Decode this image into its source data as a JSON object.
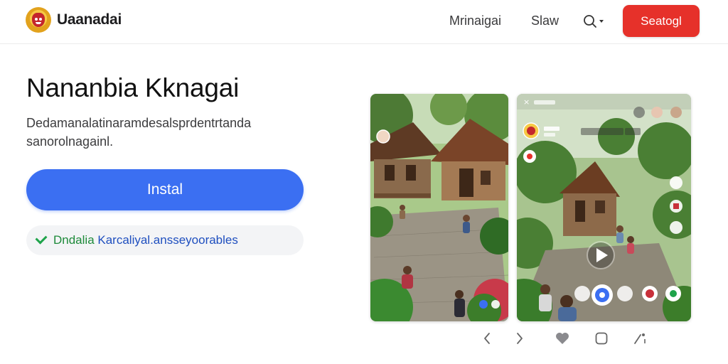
{
  "header": {
    "brand": "Uaanadai",
    "nav": [
      "Mrinaigai",
      "Slaw"
    ],
    "cta_label": "Seatogl",
    "icons": [
      "app-logo-icon",
      "search-icon",
      "chevron-down-icon"
    ]
  },
  "hero": {
    "title": "Nananbia Kknagai",
    "description_line1": "Dedamanalatinaramdesalsprdentrtanda",
    "description_line2": "sanorolnagainl.",
    "install_label": "Instal",
    "verified_prefix": "Dndalia",
    "verified_text": " Karcaliyal.ansseyoorables"
  },
  "colors": {
    "accent_red": "#e6312a",
    "accent_blue": "#3b6ff2",
    "verified_green": "#1ea34a"
  },
  "gallery": {
    "screenshots": [
      "village-courtyard-screenshot",
      "video-player-screenshot"
    ],
    "controls": [
      "chevron-left-icon",
      "chevron-right-icon",
      "heart-icon",
      "chat-bubble-icon",
      "share-icon"
    ]
  }
}
